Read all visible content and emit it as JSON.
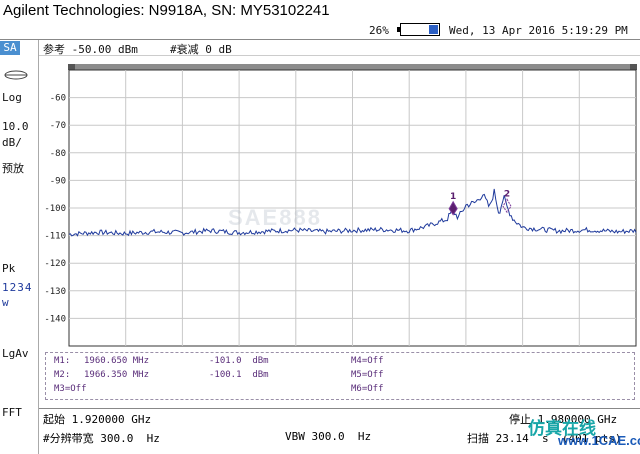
{
  "header": {
    "title": "Agilent Technologies: N9918A, SN: MY53102241",
    "battery_percent": "26%",
    "battery_level": 0.26,
    "datetime": "Wed, 13 Apr 2016 5:19:29 PM"
  },
  "sidebar": {
    "mode": "SA",
    "scale_type": "Log",
    "scale_value": "10.0",
    "scale_unit": "dB/",
    "preamp": "预放",
    "detector": "Pk",
    "trace_numbers": "1234",
    "trace_mode": "w",
    "average": "LgAv",
    "fft": "FFT"
  },
  "reference": {
    "ref_level": "参考 -50.00 dBm",
    "attenuation": "#衰减 0 dB"
  },
  "chart_data": {
    "type": "line",
    "ylim": [
      -150,
      -50
    ],
    "yticks": [
      "-60",
      "-70",
      "-80",
      "-90",
      "-100",
      "-110",
      "-120",
      "-130",
      "-140"
    ],
    "x_start_ghz": 1.92,
    "x_stop_ghz": 1.98,
    "x_ghz": [
      1.92,
      1.923,
      1.926,
      1.929,
      1.932,
      1.935,
      1.938,
      1.941,
      1.944,
      1.947,
      1.95,
      1.953,
      1.956,
      1.958,
      1.96,
      1.9606,
      1.9612,
      1.962,
      1.963,
      1.9638,
      1.9645,
      1.965,
      1.9655,
      1.966,
      1.9664,
      1.967,
      1.968,
      1.97,
      1.972,
      1.975,
      1.978,
      1.98
    ],
    "y_dbm": [
      -109.5,
      -108.8,
      -109.2,
      -108.6,
      -109.0,
      -108.2,
      -108.9,
      -108.4,
      -108.0,
      -108.6,
      -108.1,
      -107.8,
      -108.2,
      -106.5,
      -104.0,
      -101.0,
      -103.5,
      -99.0,
      -98.0,
      -95.0,
      -100.0,
      -94.0,
      -102.0,
      -96.0,
      -100.1,
      -104.0,
      -107.0,
      -107.8,
      -108.3,
      -107.9,
      -108.6,
      -108.2
    ],
    "markers": [
      {
        "label": "1",
        "x_ghz": 1.96065,
        "y_dbm": -101.0
      },
      {
        "label": "2",
        "x_ghz": 1.96635,
        "y_dbm": -100.1
      }
    ],
    "grid": true,
    "trace_color": "#1f3a9c"
  },
  "watermark": "SAE888",
  "marker_table": {
    "m1_label": "M1:",
    "m1_freq": "1960.650 MHz",
    "m1_amp": "-101.0  dBm",
    "m2_label": "M2:",
    "m2_freq": "1966.350 MHz",
    "m2_amp": "-100.1  dBm",
    "m3": "M3=Off",
    "m4": "M4=Off",
    "m5": "M5=Off",
    "m6": "M6=Off"
  },
  "bottom": {
    "start": "起始 1.920000 GHz",
    "stop": "停止 1.980000 GHz",
    "rbw": "#分辨带宽 300.0  Hz",
    "vbw": "VBW 300.0  Hz",
    "sweep": "扫描 23.14  s  (401 pts)"
  },
  "logo": {
    "text": "仿真在线",
    "url": "www.1CAE.com"
  }
}
